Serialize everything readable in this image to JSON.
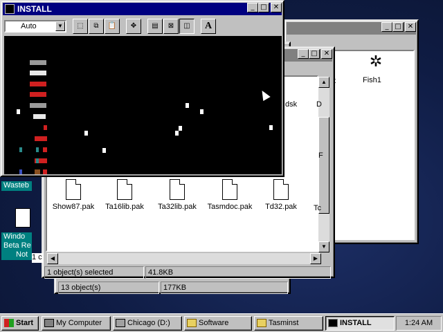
{
  "install_window": {
    "title": "INSTALL",
    "font_select": "Auto",
    "toolbar_icons": [
      "mark-icon",
      "copy-icon",
      "paste-icon",
      "fullscreen-icon",
      "properties-icon",
      "background-icon",
      "font-icon"
    ]
  },
  "tasminst_window": {
    "files": [
      "Show87.pak",
      "Ta16lib.pak",
      "Ta32lib.pak",
      "Tasmdoc.pak",
      "Td32.pak"
    ],
    "partial_labels": [
      "dsk",
      "D",
      "Tc",
      "F",
      "t"
    ],
    "status_selected": "1 object(s) selected",
    "status_size": "41.8KB"
  },
  "software_window": {
    "status_count": "13 object(s)",
    "status_size": "177KB"
  },
  "back_window": {
    "fish_label": "Fish1"
  },
  "desktop_icons": {
    "wastebasket_label": "Wasteb",
    "windows_note_line1": "Windo",
    "windows_note_line2": "Beta Re",
    "windows_note_line3": "Not",
    "partial_1": "1 c"
  },
  "taskbar": {
    "start_label": "Start",
    "items": [
      {
        "label": "My Computer"
      },
      {
        "label": "Chicago (D:)"
      },
      {
        "label": "Software"
      },
      {
        "label": "Tasminst"
      },
      {
        "label": "INSTALL"
      }
    ],
    "clock": "1:24 AM"
  }
}
